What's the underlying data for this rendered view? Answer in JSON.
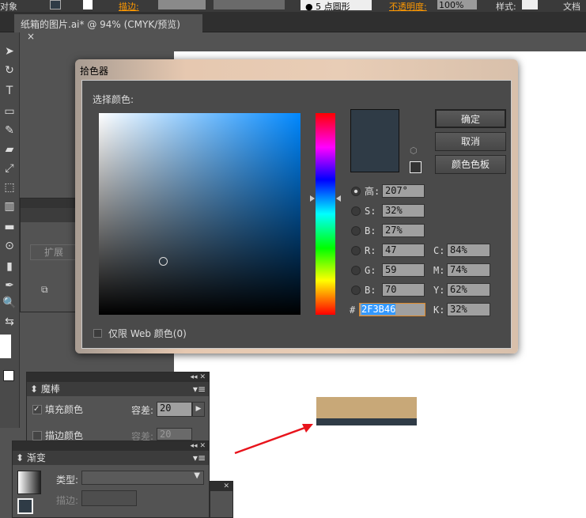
{
  "toolbar": {
    "left_label": "对象",
    "stroke_label": "描边:",
    "brush": "5 点圆形",
    "opacity_label": "不透明度:",
    "opacity": "100%",
    "style_label": "样式:",
    "doc_label": "文档"
  },
  "document_tab": {
    "title": "纸箱的图片.ai* @ 94% (CMYK/预览)",
    "close": "×"
  },
  "side_panel": {
    "expand": "扩展"
  },
  "color_picker": {
    "title": "拾色器",
    "select_label": "选择颜色:",
    "buttons": {
      "ok": "确定",
      "cancel": "取消",
      "swatches": "颜色色板"
    },
    "current_color": "#2F3B46",
    "hsb": [
      {
        "label": "高:",
        "value": "207°",
        "selected": true
      },
      {
        "label": "S:",
        "value": "32%"
      },
      {
        "label": "B:",
        "value": "27%"
      }
    ],
    "rgb": [
      {
        "label": "R:",
        "value": "47"
      },
      {
        "label": "G:",
        "value": "59"
      },
      {
        "label": "B:",
        "value": "70"
      }
    ],
    "cmyk": [
      {
        "label": "C:",
        "value": "84%"
      },
      {
        "label": "M:",
        "value": "74%"
      },
      {
        "label": "Y:",
        "value": "62%"
      },
      {
        "label": "K:",
        "value": "32%"
      }
    ],
    "hex_label": "#",
    "hex": "2F3B46",
    "web_only": "仅限 Web 颜色(0)",
    "web_only_checked": false
  },
  "magic_wand": {
    "title": "魔棒",
    "fill_color": "填充颜色",
    "fill_checked": true,
    "tolerance_label": "容差:",
    "fill_tolerance": "20",
    "stroke_color": "描边颜色",
    "stroke_checked": false,
    "stroke_tolerance": "20"
  },
  "gradient": {
    "title": "渐变",
    "type_label": "类型:",
    "stroke_label": "描边:"
  },
  "artwork": {
    "top_color": "#C8A878",
    "bottom_color": "#2F3B46",
    "arrow_color": "#E8141C"
  }
}
